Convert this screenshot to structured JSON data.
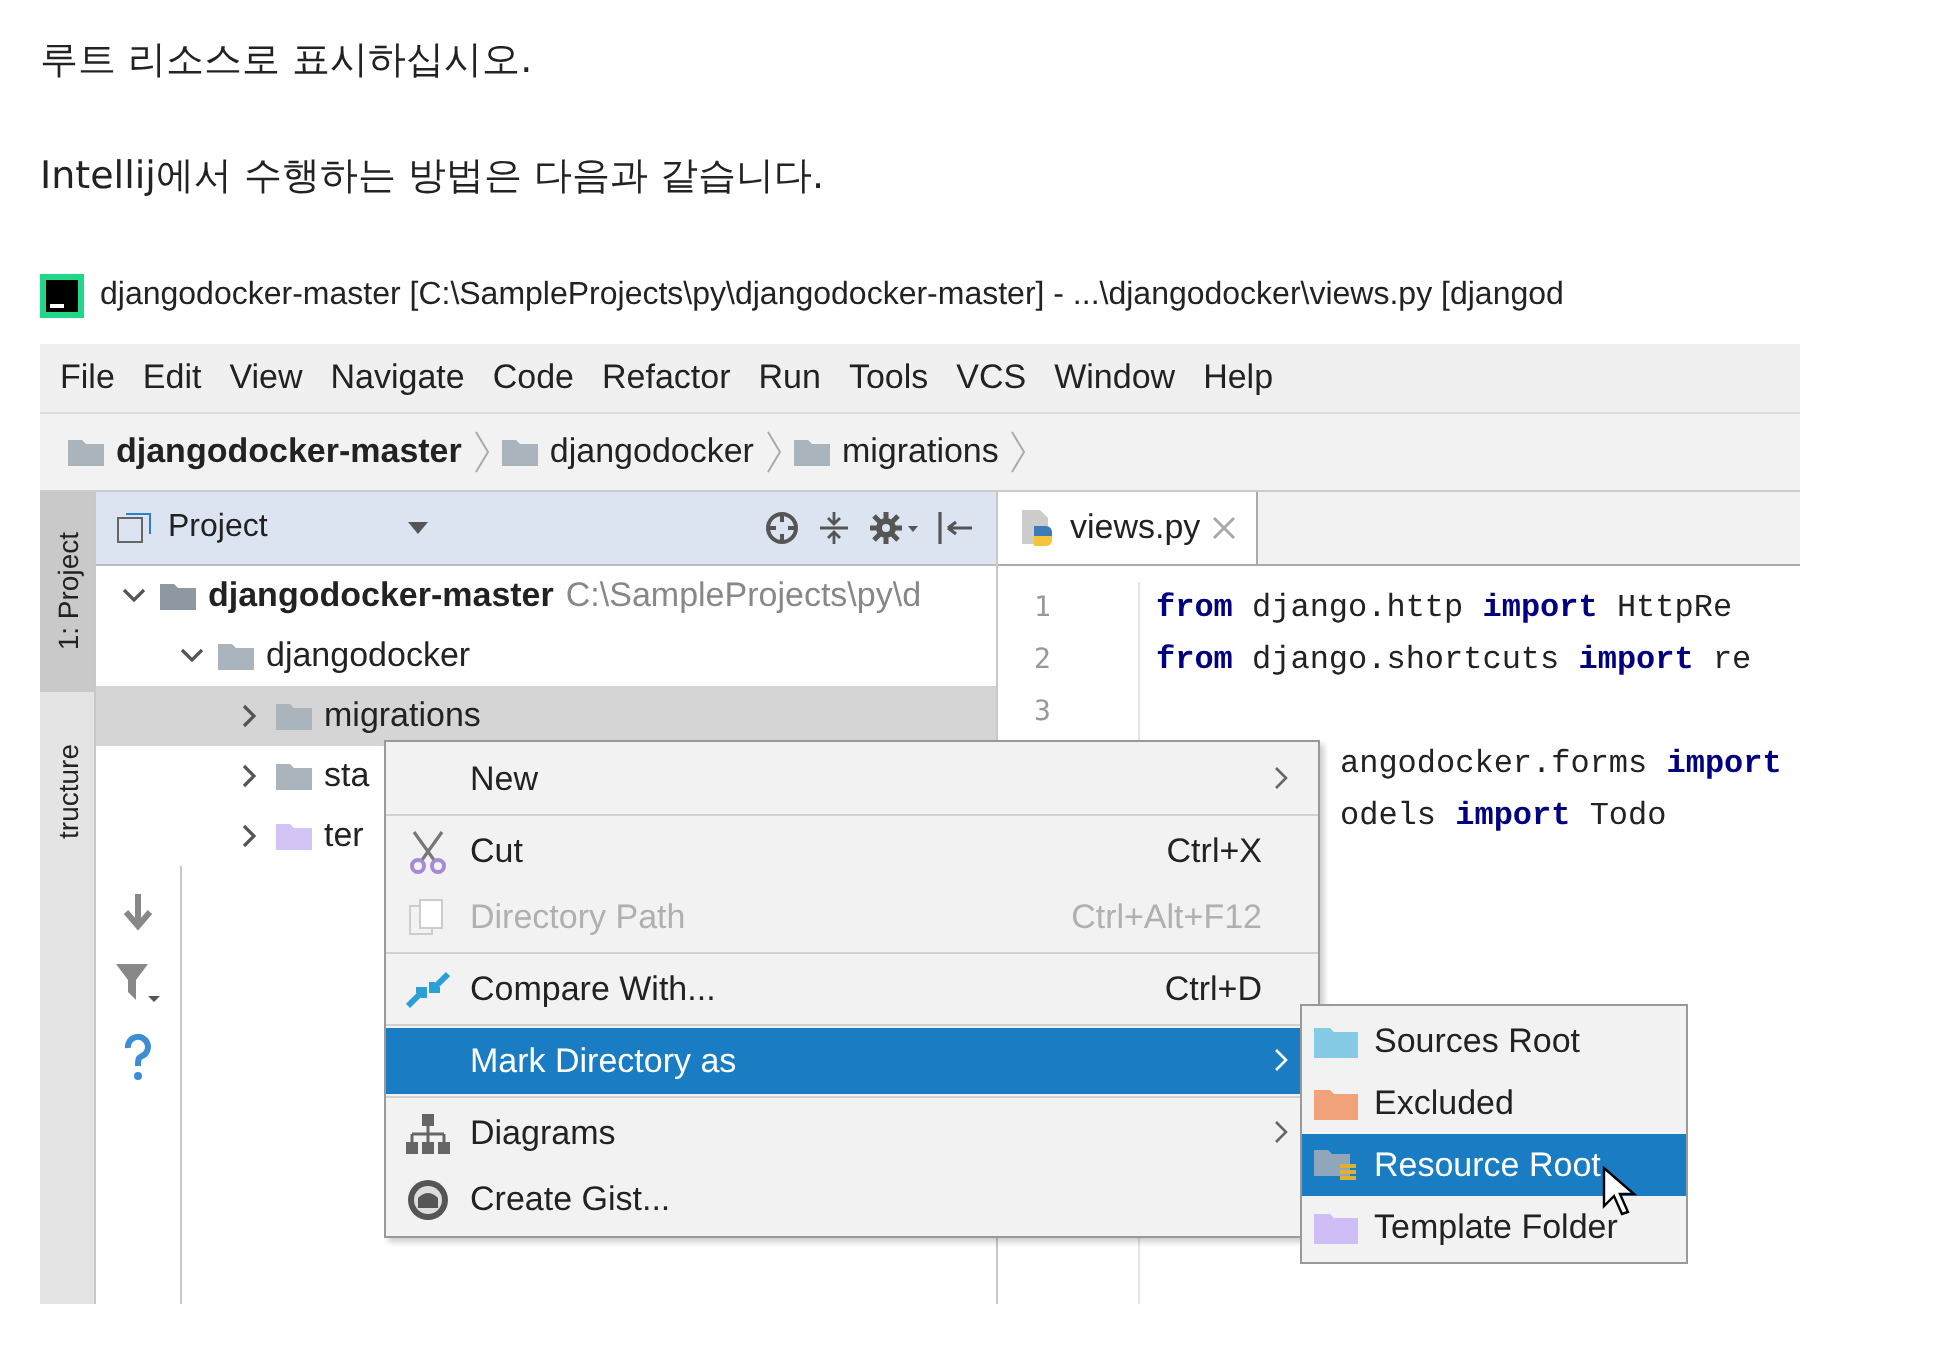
{
  "article": {
    "paragraphs": [
      "루트 리소스로 표시하십시오.",
      "Intellij에서 수행하는 방법은 다음과 같습니다."
    ]
  },
  "ide": {
    "window": {
      "title": "djangodocker-master [C:\\SampleProjects\\py\\djangodocker-master] - ...\\djangodocker\\views.py [djangod"
    },
    "menu_bar": [
      "File",
      "Edit",
      "View",
      "Navigate",
      "Code",
      "Refactor",
      "Run",
      "Tools",
      "VCS",
      "Window",
      "Help"
    ],
    "breadcrumbs": [
      {
        "label": "djangodocker-master",
        "bold": true
      },
      {
        "label": "djangodocker",
        "bold": false
      },
      {
        "label": "migrations",
        "bold": false
      }
    ],
    "side_tabs": [
      {
        "label": "1: Project",
        "selected": true
      },
      {
        "label": "tructure",
        "selected": false
      }
    ],
    "project_panel": {
      "title": "Project",
      "tree": [
        {
          "label": "djangodocker-master",
          "path": "C:\\SampleProjects\\py\\d",
          "kind": "module",
          "expanded": true,
          "selected": false,
          "children": [
            {
              "label": "djangodocker",
              "kind": "folder",
              "expanded": true,
              "selected": false,
              "children": [
                {
                  "label": "migrations",
                  "kind": "folder",
                  "expanded": false,
                  "selected": true
                },
                {
                  "label": "sta",
                  "kind": "folder",
                  "expanded": false,
                  "selected": false
                },
                {
                  "label": "ter",
                  "kind": "template",
                  "expanded": false,
                  "selected": false
                }
              ]
            }
          ]
        }
      ]
    },
    "editor": {
      "tab": {
        "label": "views.py",
        "selected": true
      },
      "lines": [
        {
          "number": "1",
          "tokens": [
            {
              "text": "from",
              "kind": "keyword"
            },
            {
              "text": " django.http ",
              "kind": "plain"
            },
            {
              "text": "import",
              "kind": "keyword"
            },
            {
              "text": " HttpRe",
              "kind": "plain"
            }
          ]
        },
        {
          "number": "2",
          "tokens": [
            {
              "text": "from",
              "kind": "keyword"
            },
            {
              "text": " django.shortcuts ",
              "kind": "plain"
            },
            {
              "text": "import",
              "kind": "keyword"
            },
            {
              "text": " re",
              "kind": "plain"
            }
          ]
        },
        {
          "number": "3"
        },
        {
          "tokens": [
            {
              "text": "angodocker.forms ",
              "kind": "plain"
            },
            {
              "text": "import",
              "kind": "keyword"
            }
          ]
        },
        {
          "tokens": [
            {
              "text": "odels ",
              "kind": "plain"
            },
            {
              "text": "import",
              "kind": "keyword"
            },
            {
              "text": " Todo",
              "kind": "plain"
            }
          ]
        }
      ]
    },
    "context_menu": {
      "items": [
        {
          "kind": "plain",
          "label": "New",
          "submenu": true,
          "selected": false,
          "disabled": false
        },
        {
          "kind": "separator"
        },
        {
          "kind": "cut",
          "label": "Cut",
          "shortcut": "Ctrl+X",
          "submenu": false,
          "selected": false,
          "disabled": false
        },
        {
          "kind": "copy-path",
          "label": "Directory Path",
          "shortcut": "Ctrl+Alt+F12",
          "submenu": false,
          "selected": false,
          "disabled": true
        },
        {
          "kind": "separator"
        },
        {
          "kind": "compare",
          "label": "Compare With...",
          "shortcut": "Ctrl+D",
          "submenu": false,
          "selected": false,
          "disabled": false
        },
        {
          "kind": "separator"
        },
        {
          "kind": "plain",
          "label": "Mark Directory as",
          "submenu": true,
          "selected": true,
          "disabled": false
        },
        {
          "kind": "separator"
        },
        {
          "kind": "diagrams",
          "label": "Diagrams",
          "submenu": true,
          "selected": false,
          "disabled": false
        },
        {
          "kind": "gist",
          "label": "Create Gist...",
          "submenu": false,
          "selected": false,
          "disabled": false
        }
      ]
    },
    "submenu": {
      "items": [
        {
          "label": "Sources Root",
          "kind": "folder",
          "color": "#86cbe6",
          "selected": false
        },
        {
          "label": "Excluded",
          "kind": "folder",
          "color": "#f0a37a",
          "selected": false
        },
        {
          "label": "Resource Root",
          "kind": "resource",
          "color": "#8fa6bb",
          "selected": true
        },
        {
          "label": "Template Folder",
          "kind": "folder",
          "color": "#cfbef5",
          "selected": false
        }
      ]
    }
  }
}
